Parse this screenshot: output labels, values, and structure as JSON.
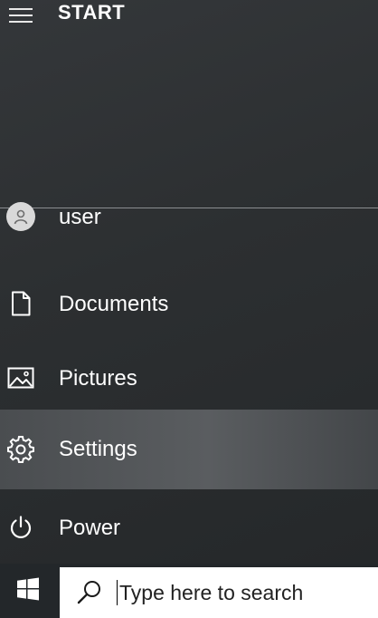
{
  "header": {
    "title": "START",
    "menu_icon": "hamburger-icon"
  },
  "menu": {
    "items": [
      {
        "label": "user",
        "icon": "user-avatar-icon",
        "highlighted": false
      },
      {
        "label": "Documents",
        "icon": "document-icon",
        "highlighted": false
      },
      {
        "label": "Pictures",
        "icon": "pictures-icon",
        "highlighted": false
      },
      {
        "label": "Settings",
        "icon": "gear-icon",
        "highlighted": true
      },
      {
        "label": "Power",
        "icon": "power-icon",
        "highlighted": false
      }
    ]
  },
  "taskbar": {
    "start_icon": "windows-logo-icon",
    "search": {
      "icon": "search-icon",
      "placeholder": "Type here to search"
    }
  },
  "colors": {
    "panel_background": "#2c2f31",
    "highlight": "#55585b",
    "taskbar": "#23272a",
    "search_box": "#ffffff",
    "text": "#ffffff"
  }
}
